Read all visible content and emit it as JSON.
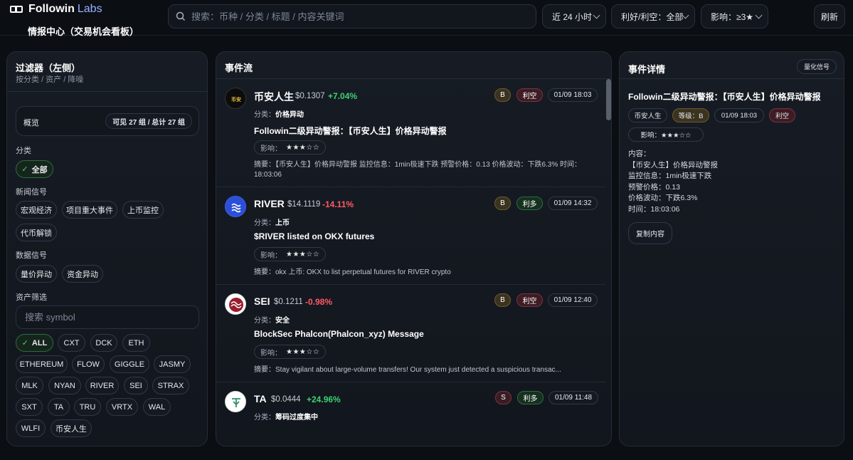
{
  "header": {
    "brand": "Followin",
    "brand_suffix": "Labs",
    "subtitle": "情报中心（交易机会看板）",
    "search_placeholder": "搜索：币种 / 分类 / 标题 / 内容关键词",
    "time_filter": "近 24 小时",
    "sentiment_filter": "利好/利空：全部",
    "impact_filter": "影响：≥3★",
    "refresh_label": "刷新"
  },
  "filters": {
    "title": "过滤器（左侧）",
    "subtitle": "按分类 / 资产 / 降噪",
    "overview_label": "概览",
    "overview_count": "可见 27 组 / 总计 27 组",
    "category_label": "分类",
    "category_all": "全部",
    "news_label": "新闻信号",
    "news_items": [
      "宏观经济",
      "项目重大事件",
      "上币监控",
      "代币解锁"
    ],
    "data_label": "数据信号",
    "data_items": [
      "量价异动",
      "资金异动"
    ],
    "asset_label": "资产筛选",
    "symbol_placeholder": "搜索 symbol",
    "assets": [
      "ALL",
      "CXT",
      "DCK",
      "ETH",
      "ETHEREUM",
      "FLOW",
      "GIGGLE",
      "JASMY",
      "MLK",
      "NYAN",
      "RIVER",
      "SEI",
      "STRAX",
      "SXT",
      "TA",
      "TRU",
      "VRTX",
      "WAL",
      "WLFI",
      "币安人生"
    ]
  },
  "feed": {
    "title": "事件流",
    "events": [
      {
        "symbol": "币安人生",
        "price": "$0.1307",
        "change": "+7.04%",
        "direction": "up",
        "grade": "B",
        "sentiment": "利空",
        "sentiment_type": "bear",
        "time": "01/09 18:03",
        "category_label": "分类：",
        "category": "价格异动",
        "title": "Followin二级异动警报：【币安人生】价格异动警报",
        "impact_label": "影响：",
        "stars": "★★★☆☆",
        "summary": "摘要：【币安人生】价格异动警报 监控信息：1min极速下跌 预警价格：0.13 价格波动：下跌6.3% 时间：18:03:06"
      },
      {
        "symbol": "RIVER",
        "price": "$14.1119",
        "change": "-14.11%",
        "direction": "down",
        "grade": "B",
        "sentiment": "利多",
        "sentiment_type": "bull",
        "time": "01/09 14:32",
        "category_label": "分类：",
        "category": "上币",
        "title": "$RIVER listed on OKX futures",
        "impact_label": "影响：",
        "stars": "★★★☆☆",
        "summary": "摘要：okx 上币: OKX to list perpetual futures for RIVER crypto"
      },
      {
        "symbol": "SEI",
        "price": "$0.1211",
        "change": "-0.98%",
        "direction": "down",
        "grade": "B",
        "sentiment": "利空",
        "sentiment_type": "bear",
        "time": "01/09 12:40",
        "category_label": "分类：",
        "category": "安全",
        "title": "BlockSec Phalcon(Phalcon_xyz) Message",
        "impact_label": "影响：",
        "stars": "★★★☆☆",
        "summary": "摘要：Stay vigilant about large-volume transfers! Our system just detected a suspicious transac..."
      },
      {
        "symbol": "TA",
        "price": "$0.0444",
        "change": "+24.96%",
        "direction": "up",
        "grade": "S",
        "sentiment": "利多",
        "sentiment_type": "bull",
        "time": "01/09 11:48",
        "category_label": "分类：",
        "category": "筹码过度集中"
      }
    ]
  },
  "detail": {
    "title": "事件详情",
    "badge": "量化信号",
    "headline": "Followin二级异动警报：【币安人生】价格异动警报",
    "symbol": "币安人生",
    "grade": "等级：B",
    "time": "01/09 18:03",
    "sentiment": "利空",
    "impact": "影响：★★★☆☆",
    "content_label": "内容：",
    "content_lines": [
      "【币安人生】价格异动警报",
      "监控信息：1min极速下跌",
      "预警价格：0.13",
      "价格波动：下跌6.3%",
      "时间：18:03:06"
    ],
    "copy_label": "复制内容"
  },
  "colors": {
    "bg": "#0b0e13",
    "up": "#3ed177",
    "down": "#ff5a66",
    "bull_chip": "#16301f",
    "bear_chip": "#3d1c24"
  }
}
